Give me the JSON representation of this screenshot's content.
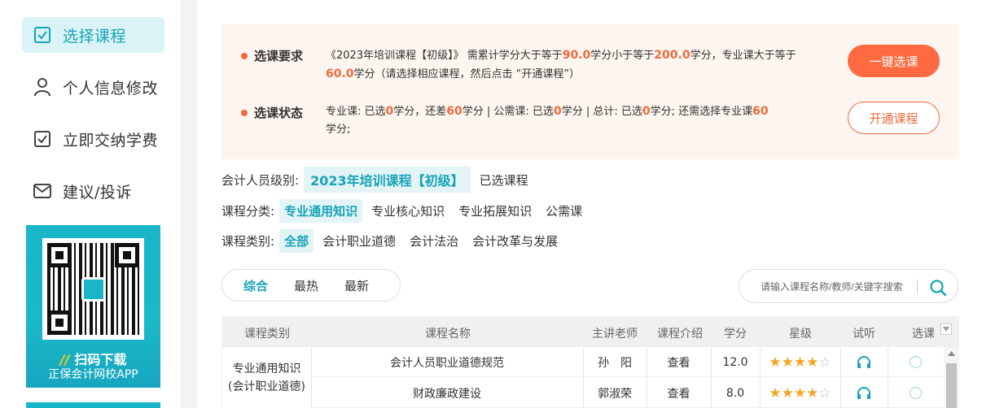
{
  "sidebar": {
    "items": [
      {
        "label": "选择课程",
        "icon": "checkbox-icon"
      },
      {
        "label": "个人信息修改",
        "icon": "user-icon"
      },
      {
        "label": "立即交纳学费",
        "icon": "checkbox-icon"
      },
      {
        "label": "建议/投诉",
        "icon": "mail-icon"
      }
    ],
    "promo": {
      "title_prefix": "//",
      "title": "扫码下载",
      "subtitle": "正保会计网校APP"
    }
  },
  "notice": {
    "requirement_label": "选课要求",
    "requirement": {
      "t1": "《2023年培训课程【初级】》 需累计学分大于等于",
      "v1": "90.0",
      "t2": "学分小于等于",
      "v2": "200.0",
      "t3": "学分，专业课大于等于",
      "v3": "60.0",
      "t4": "学分（请选择相应课程，然后点击 “开通课程”）"
    },
    "status_label": "选课状态",
    "status": {
      "t1": "专业课:  已选",
      "v1": "0",
      "t2": "学分，还差",
      "v2": "60",
      "t3": "学分 | 公需课:  已选",
      "v3": "0",
      "t4": "学分 | 总计: 已选",
      "v4": "0",
      "t5": "学分; 还需选择专业课",
      "v5": "60",
      "t6": "学分;"
    },
    "btn_one_click": "一键选课",
    "btn_open": "开通课程"
  },
  "filters": {
    "level_label": "会计人员级别:",
    "level_active": "2023年培训课程【初级】",
    "level_other": "已选课程",
    "category_label": "课程分类:",
    "categories": [
      "专业通用知识",
      "专业核心知识",
      "专业拓展知识",
      "公需课"
    ],
    "type_label": "课程类别:",
    "types": [
      "全部",
      "会计职业道德",
      "会计法治",
      "会计改革与发展"
    ]
  },
  "sort": {
    "tabs": [
      "综合",
      "最热",
      "最新"
    ]
  },
  "search": {
    "placeholder": "请输入课程名称/教师/关键字搜索"
  },
  "table": {
    "headers": [
      "课程类别",
      "课程名称",
      "主讲老师",
      "课程介绍",
      "学分",
      "星级",
      "试听",
      "选课"
    ],
    "group_label_line1": "专业通用知识",
    "group_label_line2": "(会计职业道德)",
    "rows": [
      {
        "name": "会计人员职业道德规范",
        "teacher": "孙　阳",
        "intro": "查看",
        "credit": "12.0",
        "stars": 4
      },
      {
        "name": "财政廉政建设",
        "teacher": "郭淑荣",
        "intro": "查看",
        "credit": "8.0",
        "stars": 4
      }
    ]
  },
  "colors": {
    "accent": "#17a3b8",
    "orange": "#f06a3c",
    "notice_bg": "#fdf5ef"
  }
}
